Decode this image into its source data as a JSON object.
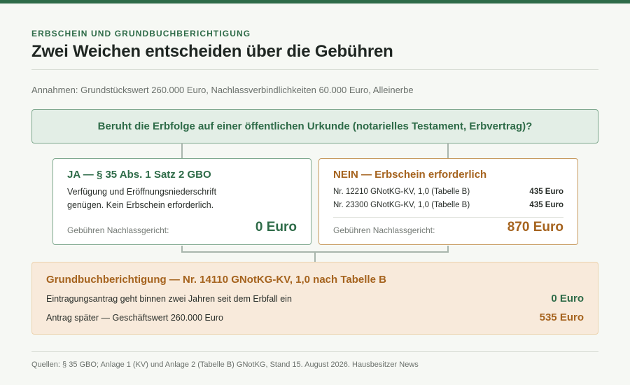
{
  "header": {
    "kicker": "ERBSCHEIN UND GRUNDBUCHBERICHTIGUNG",
    "title": "Zwei Weichen entscheiden über die Gebühren"
  },
  "assumptions": "Annahmen: Grundstückswert 260.000 Euro, Nachlassverbindlichkeiten 60.000 Euro, Alleinerbe",
  "question": "Beruht die Erbfolge auf einer öffentlichen Urkunde (notarielles Testament, Erbvertrag)?",
  "branch_yes": {
    "heading": "JA — § 35 Abs. 1 Satz 2 GBO",
    "line1": "Verfügung und Eröffnungsniederschrift",
    "line2": "genügen. Kein Erbschein erforderlich.",
    "total_label": "Gebühren Nachlassgericht:",
    "total_value": "0 Euro"
  },
  "branch_no": {
    "heading": "NEIN — Erbschein erforderlich",
    "fees": [
      {
        "label": "Nr. 12210 GNotKG-KV, 1,0 (Tabelle B)",
        "amount": "435 Euro"
      },
      {
        "label": "Nr. 23300 GNotKG-KV, 1,0 (Tabelle B)",
        "amount": "435 Euro"
      }
    ],
    "total_label": "Gebühren Nachlassgericht:",
    "total_value": "870 Euro"
  },
  "grundbuch": {
    "heading": "Grundbuchberichtigung — Nr. 14110 GNotKG-KV, 1,0 nach Tabelle B",
    "rows": [
      {
        "label": "Eintragungsantrag geht binnen zwei Jahren seit dem Erbfall ein",
        "value": "0 Euro"
      },
      {
        "label": "Antrag später — Geschäftswert 260.000 Euro",
        "value": "535 Euro"
      }
    ]
  },
  "sources": "Quellen: § 35 GBO; Anlage 1 (KV) und Anlage 2 (Tabelle B) GNotKG, Stand 15. August 2026. Hausbesitzer News",
  "colors": {
    "accent_green": "#2e6b48",
    "accent_brown": "#a5631e",
    "question_bg": "#e3eee6",
    "grundbuch_bg": "#f8eadb"
  }
}
